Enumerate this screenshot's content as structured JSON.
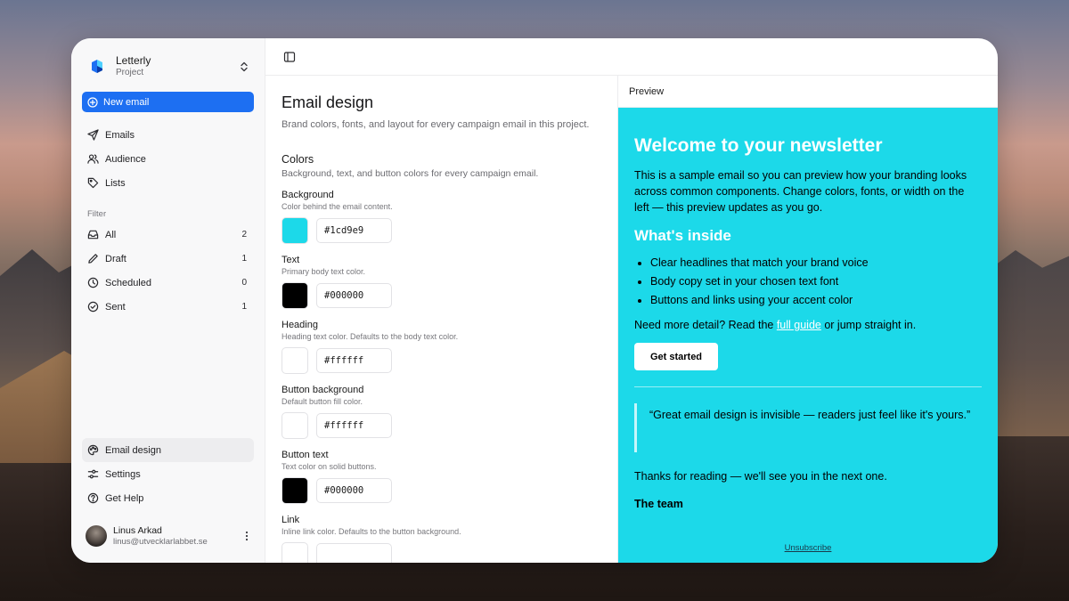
{
  "app": {
    "name": "Letterly",
    "subtitle": "Project"
  },
  "sidebar": {
    "new_email_label": "New email",
    "primary": [
      {
        "label": "Emails",
        "icon": "send-icon"
      },
      {
        "label": "Audience",
        "icon": "users-icon"
      },
      {
        "label": "Lists",
        "icon": "tag-icon"
      }
    ],
    "filter_label": "Filter",
    "filters": [
      {
        "label": "All",
        "count": "2",
        "icon": "inbox-icon"
      },
      {
        "label": "Draft",
        "count": "1",
        "icon": "pencil-icon"
      },
      {
        "label": "Scheduled",
        "count": "0",
        "icon": "clock-icon"
      },
      {
        "label": "Sent",
        "count": "1",
        "icon": "check-circle-icon"
      }
    ],
    "bottom": [
      {
        "label": "Email design",
        "icon": "palette-icon",
        "active": true
      },
      {
        "label": "Settings",
        "icon": "sliders-icon"
      },
      {
        "label": "Get Help",
        "icon": "help-circle-icon"
      }
    ],
    "user": {
      "name": "Linus Arkad",
      "email": "linus@utvecklarlabbet.se"
    }
  },
  "form": {
    "title": "Email design",
    "description": "Brand colors, fonts, and layout for every campaign email in this project.",
    "colors_heading": "Colors",
    "colors_description": "Background, text, and button colors for every campaign email.",
    "fields": [
      {
        "label": "Background",
        "help": "Color behind the email content.",
        "value": "#1cd9e9"
      },
      {
        "label": "Text",
        "help": "Primary body text color.",
        "value": "#000000"
      },
      {
        "label": "Heading",
        "help": "Heading text color. Defaults to the body text color.",
        "value": "#ffffff"
      },
      {
        "label": "Button background",
        "help": "Default button fill color.",
        "value": "#ffffff"
      },
      {
        "label": "Button text",
        "help": "Text color on solid buttons.",
        "value": "#000000"
      },
      {
        "label": "Link",
        "help": "Inline link color. Defaults to the button background.",
        "value": ""
      }
    ]
  },
  "preview": {
    "label": "Preview",
    "colors": {
      "background": "#1cd9e9",
      "text": "#000000",
      "heading": "#ffffff",
      "button_bg": "#ffffff",
      "button_text": "#000000",
      "link": "#ffffff"
    },
    "title": "Welcome to your newsletter",
    "intro": "This is a sample email so you can preview how your branding looks across common components. Change colors, fonts, or width on the left — this preview updates as you go.",
    "subheading": "What's inside",
    "bullets": [
      "Clear headlines that match your brand voice",
      "Body copy set in your chosen text font",
      "Buttons and links using your accent color"
    ],
    "more_prefix": "Need more detail? Read the ",
    "more_link": "full guide",
    "more_suffix": " or jump straight in.",
    "cta_label": "Get started",
    "quote": "“Great email design is invisible — readers just feel like it's yours.”",
    "thanks": "Thanks for reading — we'll see you in the next one.",
    "signoff": "The team",
    "unsubscribe": "Unsubscribe"
  }
}
